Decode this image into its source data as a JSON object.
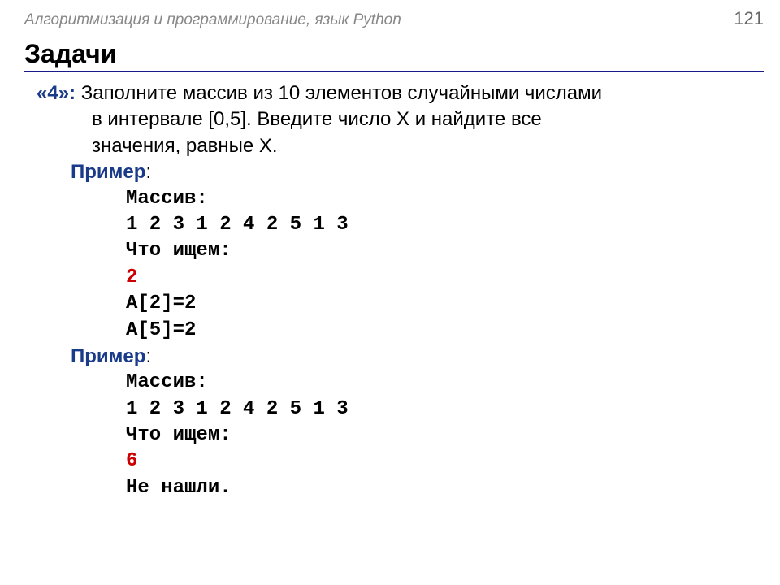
{
  "header": {
    "subject": "Алгоритмизация и программирование, язык Python",
    "page_number": "121"
  },
  "title": "Задачи",
  "task": {
    "label": "«4»:",
    "line1": "Заполните массив из 10 элементов случайными числами",
    "line2": "в интервале [0,5]. Введите число X и найдите все",
    "line3": "значения, равные X."
  },
  "example1": {
    "label": "Пример",
    "colon": ":",
    "array_label": "Массив:",
    "array_values": "1 2 3 1 2 4 2 5 1 3",
    "search_label": "Что ищем:",
    "search_value": "2",
    "result1": "A[2]=2",
    "result2": "A[5]=2"
  },
  "example2": {
    "label": "Пример",
    "colon": ":",
    "array_label": "Массив:",
    "array_values": "1 2 3 1 2 4 2 5 1 3",
    "search_label": "Что ищем:",
    "search_value": "6",
    "result": "Не нашли."
  }
}
